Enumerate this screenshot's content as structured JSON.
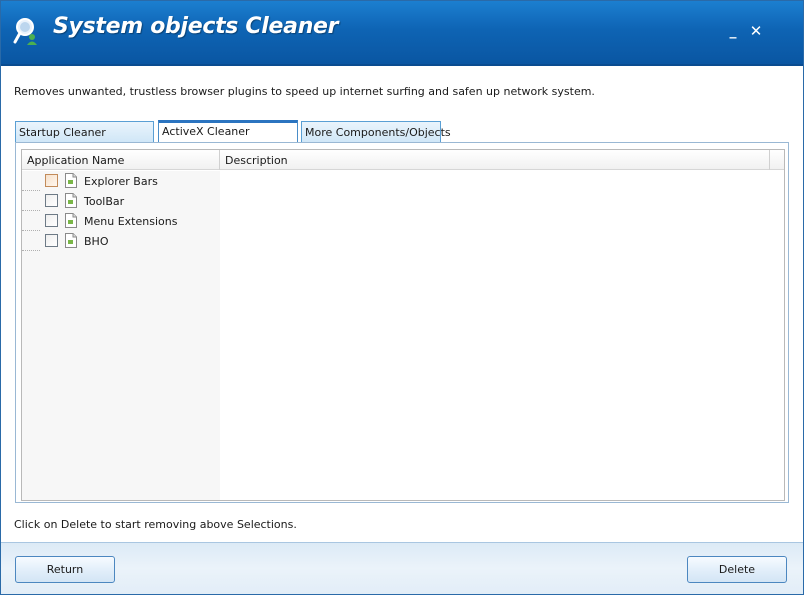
{
  "window": {
    "title": "System objects Cleaner",
    "minimize_label": "_",
    "close_label": "✕",
    "icon": "magnifier-user-icon",
    "colors": {
      "titlebar": "#0e64b4",
      "accent": "#2b74c0"
    }
  },
  "description": "Removes unwanted, trustless browser plugins to speed up internet surfing and safen up network system.",
  "tabs": [
    {
      "label": "Startup Cleaner",
      "selected": false
    },
    {
      "label": "ActiveX Cleaner",
      "selected": true
    },
    {
      "label": "More Components/Objects",
      "selected": false
    }
  ],
  "listview": {
    "columns": [
      "Application Name",
      "Description"
    ],
    "rows": [
      {
        "label": "Explorer Bars",
        "checked": false,
        "icon": "document-icon"
      },
      {
        "label": "ToolBar",
        "checked": false,
        "icon": "document-icon"
      },
      {
        "label": "Menu Extensions",
        "checked": false,
        "icon": "document-icon"
      },
      {
        "label": "BHO",
        "checked": false,
        "icon": "document-icon"
      }
    ]
  },
  "footer_hint": "Click on Delete to start removing above Selections.",
  "buttons": {
    "return_label": "Return",
    "delete_label": "Delete"
  }
}
